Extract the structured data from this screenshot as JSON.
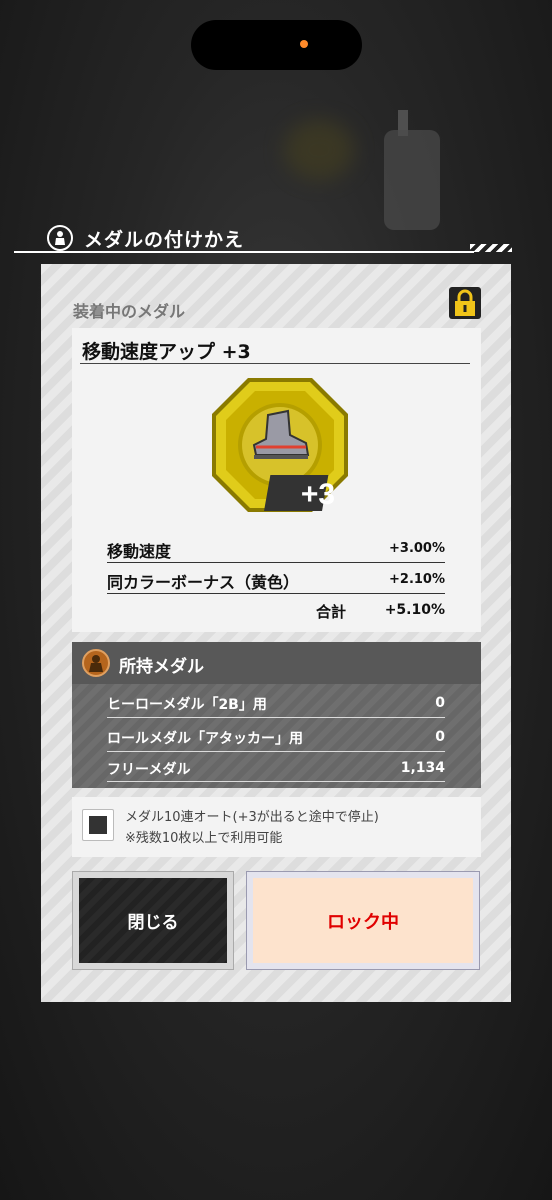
{
  "header": {
    "title": "メダルの付けかえ"
  },
  "equipped": {
    "section_label": "装着中のメダル",
    "medal_name": "移動速度アップ +3",
    "medal_level_badge": "+3",
    "medal_icon": "boot-icon",
    "stats": [
      {
        "label": "移動速度",
        "value": "+3.00%"
      },
      {
        "label": "同カラーボーナス（黄色）",
        "value": "+2.10%"
      }
    ],
    "total_label": "合計",
    "total_value": "+5.10%"
  },
  "owned": {
    "title": "所持メダル",
    "rows": [
      {
        "label": "ヒーローメダル「2B」用",
        "value": "0"
      },
      {
        "label": "ロールメダル「アタッカー」用",
        "value": "0"
      },
      {
        "label": "フリーメダル",
        "value": "1,134"
      }
    ]
  },
  "auto": {
    "line1": "メダル10連オート(+3が出ると途中で停止)",
    "line2": "※残数10枚以上で利用可能",
    "checked": false
  },
  "buttons": {
    "close_label": "閉じる",
    "lock_label": "ロック中"
  },
  "colors": {
    "accent_red": "#e00000",
    "medal_gold": "#d9c20a",
    "lock_yellow": "#f0c419"
  }
}
